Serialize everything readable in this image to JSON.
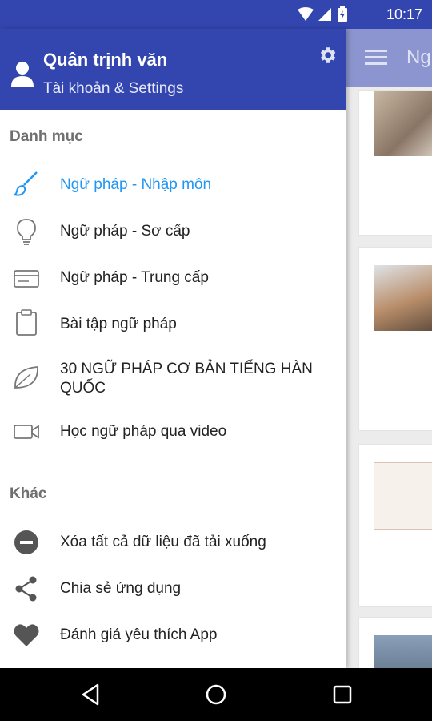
{
  "status_bar": {
    "time": "10:17"
  },
  "background_app": {
    "title_fragment": "Ng"
  },
  "drawer": {
    "user_name": "Quân trịnh văn",
    "account_link": "Tài khoản & Settings",
    "sections": [
      {
        "title": "Danh mục",
        "items": [
          {
            "label": "Ngữ pháp - Nhập môn",
            "icon": "brush-icon",
            "active": true
          },
          {
            "label": "Ngữ pháp - Sơ cấp",
            "icon": "lightbulb-icon"
          },
          {
            "label": "Ngữ pháp - Trung cấp",
            "icon": "card-icon"
          },
          {
            "label": "Bài tập ngữ pháp",
            "icon": "clipboard-icon"
          },
          {
            "label": "30 NGỮ PHÁP CƠ BẢN TIẾNG HÀN QUỐC",
            "icon": "leaf-icon"
          },
          {
            "label": "Học ngữ pháp qua video",
            "icon": "video-icon"
          }
        ]
      },
      {
        "title": "Khác",
        "items": [
          {
            "label": "Xóa tất cả dữ liệu đã tải xuống",
            "icon": "remove-circle-icon"
          },
          {
            "label": "Chia sẻ ứng dụng",
            "icon": "share-icon"
          },
          {
            "label": "Đánh giá yêu thích App",
            "icon": "heart-icon"
          }
        ]
      }
    ]
  },
  "colors": {
    "primary": "#3346b0",
    "active_item": "#2196f3"
  }
}
